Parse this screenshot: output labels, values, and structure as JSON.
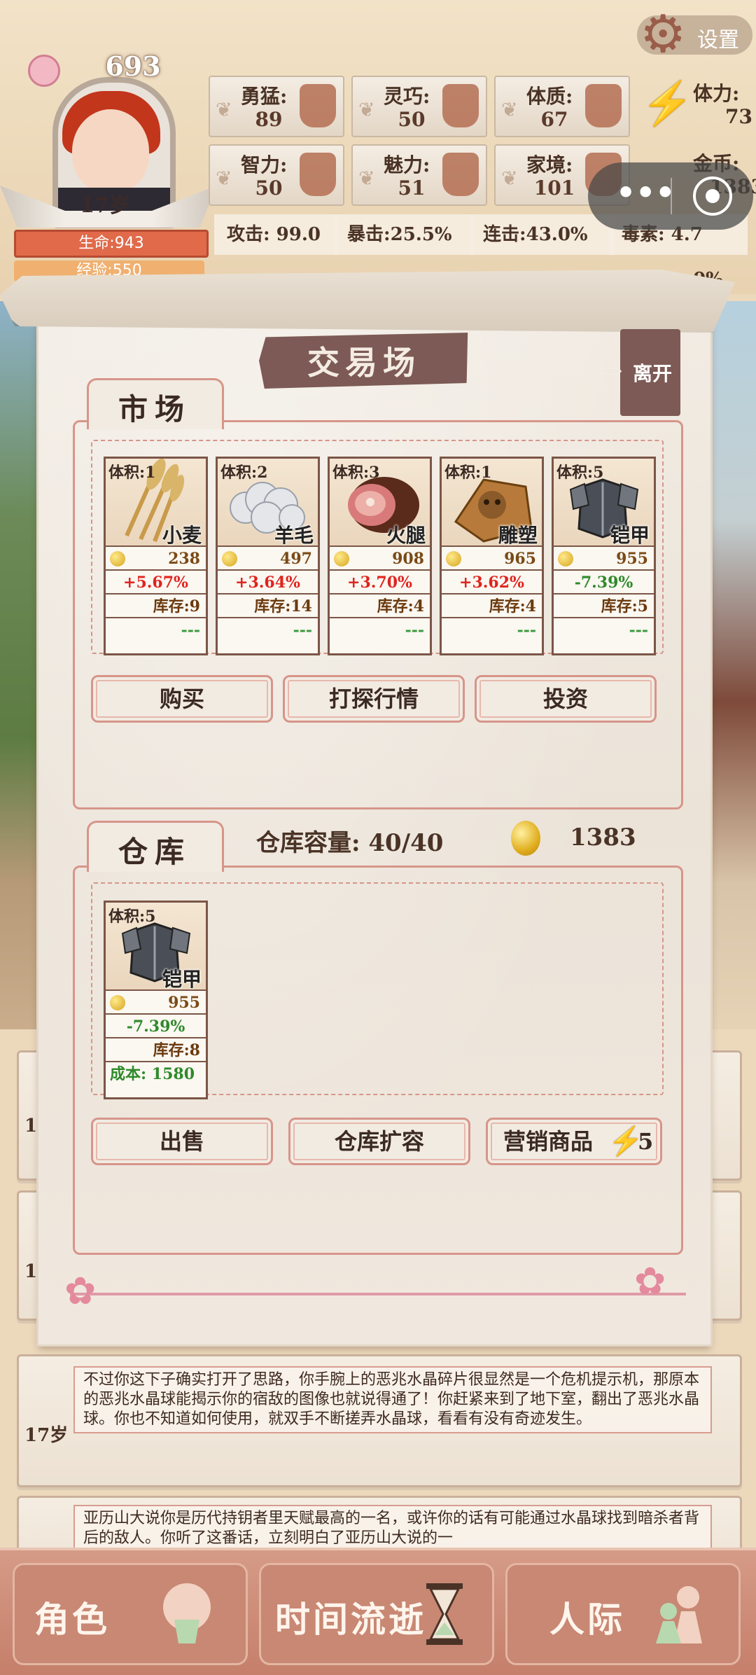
{
  "player": {
    "score": "693",
    "age": "17岁",
    "hp": "生命:943",
    "exp": "经验:550"
  },
  "stats": [
    {
      "label": "勇猛:",
      "value": "89"
    },
    {
      "label": "灵巧:",
      "value": "50"
    },
    {
      "label": "体质:",
      "value": "67"
    },
    {
      "label": "智力:",
      "value": "50"
    },
    {
      "label": "魅力:",
      "value": "51"
    },
    {
      "label": "家境:",
      "value": "101"
    }
  ],
  "energy": {
    "label": "体力:",
    "value": "73"
  },
  "gold": {
    "label": "金币:",
    "value": "1383"
  },
  "combat": [
    {
      "text": "攻击: 99.0"
    },
    {
      "text": "暴击:25.5%"
    },
    {
      "text": "连击:43.0%"
    },
    {
      "text": "毒素:  4.7"
    }
  ],
  "combat_extra": "0%",
  "settings_label": "设置",
  "capsule": {
    "dots": "•••"
  },
  "panel": {
    "title": "交易场",
    "leave": "离开",
    "market_tab": "市场",
    "warehouse_tab": "仓库",
    "capacity": "仓库容量: 40/40",
    "coins": "1383"
  },
  "market_items": [
    {
      "volume": "体积:1",
      "name": "小麦",
      "price": "238",
      "change": "+5.67%",
      "stock": "库存:9",
      "extra": "---"
    },
    {
      "volume": "体积:2",
      "name": "羊毛",
      "price": "497",
      "change": "+3.64%",
      "stock": "库存:14",
      "extra": "---"
    },
    {
      "volume": "体积:3",
      "name": "火腿",
      "price": "908",
      "change": "+3.70%",
      "stock": "库存:4",
      "extra": "---"
    },
    {
      "volume": "体积:1",
      "name": "雕塑",
      "price": "965",
      "change": "+3.62%",
      "stock": "库存:4",
      "extra": "---"
    },
    {
      "volume": "体积:5",
      "name": "铠甲",
      "price": "955",
      "change": "-7.39%",
      "stock": "库存:5",
      "extra": "---"
    }
  ],
  "market_buttons": [
    "购买",
    "打探行情",
    "投资"
  ],
  "warehouse_items": [
    {
      "volume": "体积:5",
      "name": "铠甲",
      "price": "955",
      "change": "-7.39%",
      "stock": "库存:8",
      "cost": "成本: 1580"
    }
  ],
  "warehouse_buttons": {
    "sell": "出售",
    "expand": "仓库扩容",
    "market": "营销商品",
    "market_cost": "5"
  },
  "events": [
    {
      "age": "17",
      "text": ""
    },
    {
      "age": "17",
      "text": ""
    },
    {
      "age": "17岁",
      "text": "不过你这下子确实打开了思路，你手腕上的恶兆水晶碎片很显然是一个危机提示机，那原本的恶兆水晶球能揭示你的宿敌的图像也就说得通了！你赶紧来到了地下室，翻出了恶兆水晶球。你也不知道如何使用，就双手不断搓弄水晶球，看看有没有奇迹发生。"
    },
    {
      "age": "",
      "text": "亚历山大说你是历代持钥者里天赋最高的一名，或许你的话有可能通过水晶球找到暗杀者背后的敌人。你听了这番话，立刻明白了亚历山大说的一"
    }
  ],
  "nav": [
    {
      "label": "角色"
    },
    {
      "label": "时间流逝"
    },
    {
      "label": "人际"
    }
  ],
  "colors": {
    "accent": "#d7958a",
    "banner": "#7d5a55",
    "nav": "#c88874",
    "up": "#e0241e",
    "down": "#2e8a2a"
  }
}
